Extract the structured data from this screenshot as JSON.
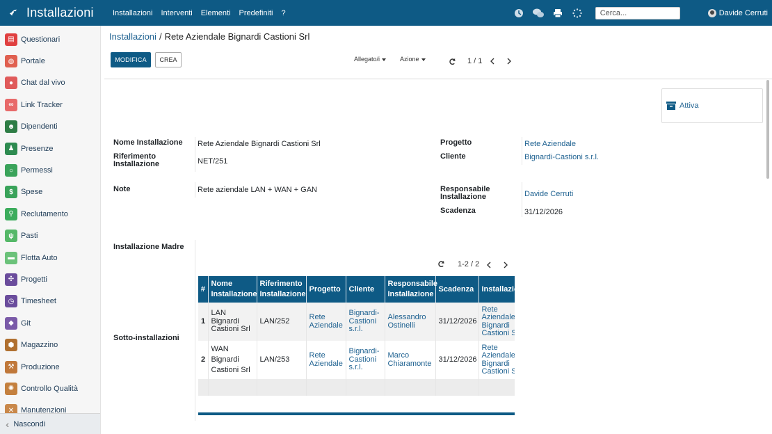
{
  "app": {
    "title": "Installazioni",
    "menu": [
      "Installazioni",
      "Interventi",
      "Elementi",
      "Predefiniti",
      "?"
    ],
    "search_placeholder": "Cerca...",
    "user_name": "Davide Cerruti"
  },
  "sidebar": {
    "items": [
      {
        "label": "Questionari",
        "color": "#e04040",
        "icon": "clipboard-icon"
      },
      {
        "label": "Portale",
        "color": "#e06050",
        "icon": "globe-icon"
      },
      {
        "label": "Chat dal vivo",
        "color": "#e05a5a",
        "icon": "chat-icon"
      },
      {
        "label": "Link Tracker",
        "color": "#e86a6a",
        "icon": "link-icon"
      },
      {
        "label": "Dipendenti",
        "color": "#2e7d45",
        "icon": "users-icon"
      },
      {
        "label": "Presenze",
        "color": "#2e8b50",
        "icon": "user-check-icon"
      },
      {
        "label": "Permessi",
        "color": "#3aa35a",
        "icon": "calendar-icon"
      },
      {
        "label": "Spese",
        "color": "#3aa35a",
        "icon": "dollar-icon"
      },
      {
        "label": "Reclutamento",
        "color": "#3cac5c",
        "icon": "search-person-icon"
      },
      {
        "label": "Pasti",
        "color": "#55b868",
        "icon": "cutlery-icon"
      },
      {
        "label": "Flotta Auto",
        "color": "#6bc27a",
        "icon": "car-icon"
      },
      {
        "label": "Progetti",
        "color": "#6a4c9c",
        "icon": "puzzle-icon"
      },
      {
        "label": "Timesheet",
        "color": "#6a4c9c",
        "icon": "clock-icon"
      },
      {
        "label": "Git",
        "color": "#7a5aa8",
        "icon": "git-icon"
      },
      {
        "label": "Magazzino",
        "color": "#b07030",
        "icon": "cube-icon"
      },
      {
        "label": "Produzione",
        "color": "#c0783a",
        "icon": "wrench-icon"
      },
      {
        "label": "Controllo Qualità",
        "color": "#c4803e",
        "icon": "gauge-icon"
      },
      {
        "label": "Manutenzioni",
        "color": "#c9884a",
        "icon": "tools-icon"
      }
    ],
    "hide_label": "Nascondi"
  },
  "control": {
    "breadcrumb_parent": "Installazioni",
    "breadcrumb_sep": "/",
    "breadcrumb_current": "Rete Aziendale Bignardi Castioni Srl",
    "edit_label": "MODIFICA",
    "create_label": "CREA",
    "attachments_label": "Allegato/i",
    "action_label": "Azione",
    "pager": "1 / 1"
  },
  "form": {
    "status_button": "Attiva",
    "fields": {
      "nome_label": "Nome Installazione",
      "nome_value": "Rete Aziendale Bignardi Castioni Srl",
      "rif_label_1": "Riferimento",
      "rif_label_2": "Installazione",
      "rif_value": "NET/251",
      "note_label": "Note",
      "note_value": "Rete aziendale LAN + WAN + GAN",
      "progetto_label": "Progetto",
      "progetto_value": "Rete Aziendale",
      "cliente_label": "Cliente",
      "cliente_value": "Bignardi-Castioni s.r.l.",
      "resp_label_1": "Responsabile",
      "resp_label_2": "Installazione",
      "resp_value": "Davide Cerruti",
      "scadenza_label": "Scadenza",
      "scadenza_value": "31/12/2026",
      "madre_label": "Installazione Madre",
      "sotto_label": "Sotto-installazioni"
    }
  },
  "subtable": {
    "pager": "1-2 / 2",
    "headers": [
      "#",
      "Nome Installazione",
      "Riferimento Installazione",
      "Progetto",
      "Cliente",
      "Responsabile Installazione",
      "Scadenza",
      "Installazione Madre"
    ],
    "rows": [
      {
        "n": "1",
        "nome": "LAN Bignardi Castioni Srl",
        "rif": "LAN/252",
        "progetto": "Rete Aziendale",
        "cliente": "Bignardi-Castioni s.r.l.",
        "resp": "Alessandro Ostinelli",
        "scadenza": "31/12/2026",
        "madre": "Rete Aziendale Bignardi Castioni Srl"
      },
      {
        "n": "2",
        "nome": "WAN Bignardi Castioni Srl",
        "rif": "LAN/253",
        "progetto": "Rete Aziendale",
        "cliente": "Bignardi-Castioni s.r.l.",
        "resp": "Marco Chiaramonte",
        "scadenza": "31/12/2026",
        "madre": "Rete Aziendale Bignardi Castioni Srl"
      }
    ]
  }
}
